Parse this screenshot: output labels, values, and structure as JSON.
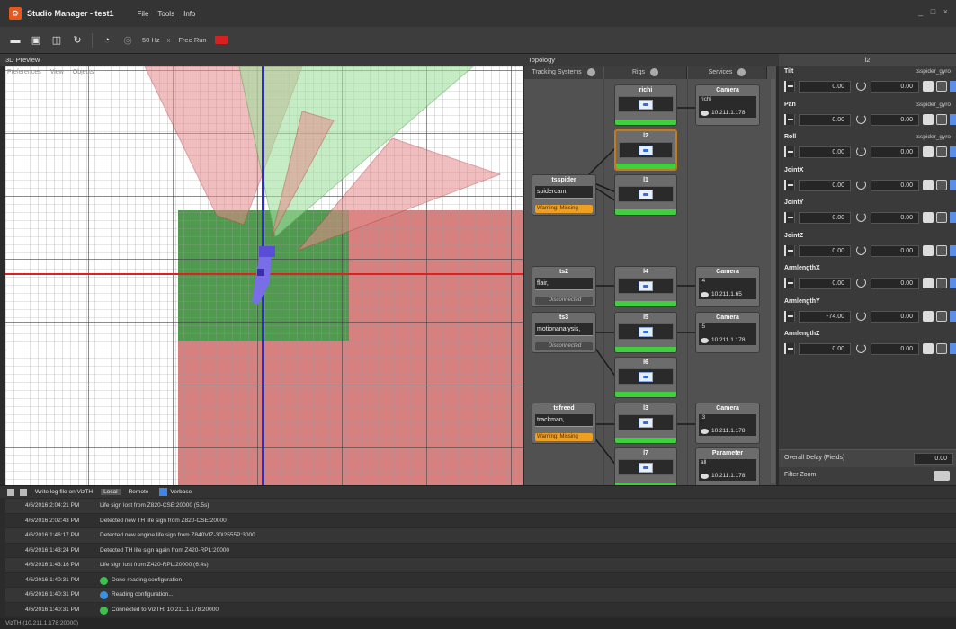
{
  "window": {
    "title": "Studio Manager - test1",
    "controls": "_ □ ×"
  },
  "menu": [
    "File",
    "Tools",
    "Info"
  ],
  "toolbar": {
    "rate": "50 Hz",
    "mode": "Free Run",
    "clear": "x"
  },
  "preview": {
    "title": "3D Preview",
    "submenu": [
      "Preferences",
      "View",
      "Objects"
    ]
  },
  "topology": {
    "title": "Topology",
    "tabs": [
      "Tracking Systems",
      "Rigs",
      "Services"
    ],
    "tracking_systems": [
      {
        "name": "tsspider",
        "value": "spidercam,",
        "status": "Warning: Missing",
        "state": "warning"
      },
      {
        "name": "ts2",
        "value": "flair,",
        "status": "Disconnected",
        "state": "disconnected"
      },
      {
        "name": "ts3",
        "value": "motionanalysis,",
        "status": "Disconnected",
        "state": "disconnected"
      },
      {
        "name": "tsfreed",
        "value": "trackman,",
        "status": "Warning: Missing",
        "state": "warning"
      }
    ],
    "rigs": [
      "richi",
      "l2",
      "l1",
      "l4",
      "l5",
      "l6",
      "l3",
      "l7"
    ],
    "services": [
      {
        "name": "Camera",
        "sub": "richi",
        "ip": "10.211.1.178"
      },
      {
        "name": "Camera",
        "sub": "l4",
        "ip": "10.211.1.65"
      },
      {
        "name": "Camera",
        "sub": "l5",
        "ip": "10.211.1.178"
      },
      {
        "name": "Camera",
        "sub": "l3",
        "ip": "10.211.1.178"
      },
      {
        "name": "Parameter",
        "sub": "all",
        "ip": "10.211.1.178"
      }
    ]
  },
  "properties": {
    "title": "l2",
    "rows": [
      {
        "name": "Tilt",
        "ref": "tsspider_gyro",
        "value": "0.00",
        "offset": "0.00"
      },
      {
        "name": "Pan",
        "ref": "tsspider_gyro",
        "value": "0.00",
        "offset": "0.00"
      },
      {
        "name": "Roll",
        "ref": "tsspider_gyro",
        "value": "0.00",
        "offset": "0.00"
      },
      {
        "name": "JointX",
        "ref": "",
        "value": "0.00",
        "offset": "0.00"
      },
      {
        "name": "JointY",
        "ref": "",
        "value": "0.00",
        "offset": "0.00"
      },
      {
        "name": "JointZ",
        "ref": "",
        "value": "0.00",
        "offset": "0.00"
      },
      {
        "name": "ArmlengthX",
        "ref": "",
        "value": "0.00",
        "offset": "0.00"
      },
      {
        "name": "ArmlengthY",
        "ref": "",
        "value": "-74.00",
        "offset": "0.00"
      },
      {
        "name": "ArmlengthZ",
        "ref": "",
        "value": "0.00",
        "offset": "0.00"
      }
    ],
    "overall_delay_label": "Overall Delay (Fields)",
    "overall_delay_value": "0.00",
    "filter_zoom_label": "Filter Zoom"
  },
  "log": {
    "write_label": "Write log file on VizTH",
    "filter_local": "Local",
    "filter_remote": "Remote",
    "verbose_label": "Verbose",
    "entries": [
      {
        "time": "4/6/2016 2:04:21 PM",
        "icon": "",
        "msg": "Life sign lost from Z820-CSE:20000 (5.5s)"
      },
      {
        "time": "4/6/2016 2:02:43 PM",
        "icon": "",
        "msg": "Detected new TH life sign from Z820-CSE:20000"
      },
      {
        "time": "4/6/2016 1:46:17 PM",
        "icon": "",
        "msg": "Detected new engine life sign from Z840VIZ-30I2555P:3000"
      },
      {
        "time": "4/6/2016 1:43:24 PM",
        "icon": "",
        "msg": "Detected TH life sign again from Z420-RPL:20000"
      },
      {
        "time": "4/6/2016 1:43:16 PM",
        "icon": "",
        "msg": "Life sign lost from Z420-RPL:20000 (6.4s)"
      },
      {
        "time": "4/6/2016 1:40:31 PM",
        "icon": "ok",
        "msg": "Done reading configuration"
      },
      {
        "time": "4/6/2016 1:40:31 PM",
        "icon": "info",
        "msg": "Reading configuration..."
      },
      {
        "time": "4/6/2016 1:40:31 PM",
        "icon": "ok",
        "msg": "Connected to VizTH: 10.211.1.178:20000"
      }
    ]
  },
  "status": "VizTH (10.211.1.178:20000)"
}
